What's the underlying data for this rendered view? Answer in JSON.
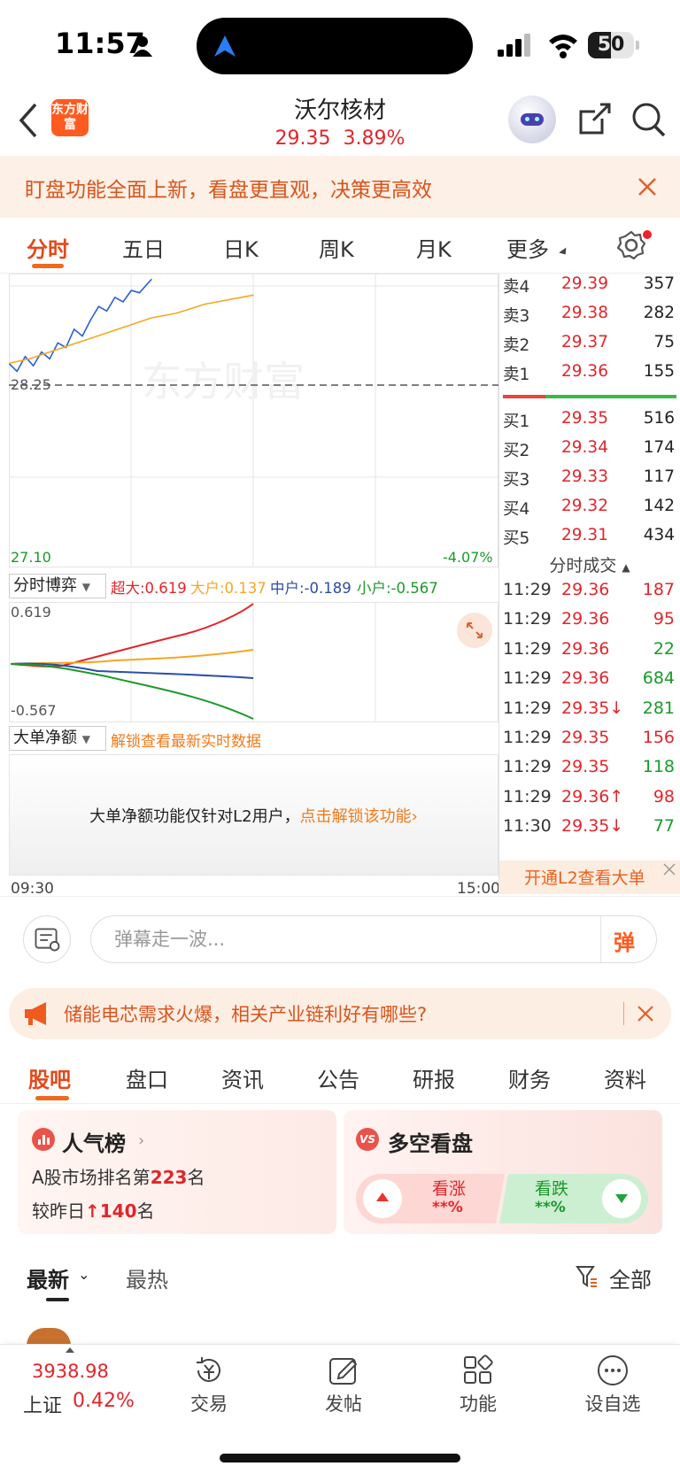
{
  "status_bar": {
    "time": "11:57",
    "battery": "50"
  },
  "header": {
    "logo": "东方财富",
    "stock_name": "沃尔核材",
    "price": "29.35",
    "change_pct": "3.89%"
  },
  "banner": {
    "text": "盯盘功能全面上新，看盘更直观，决策更高效"
  },
  "period_tabs": [
    "分时",
    "五日",
    "日K",
    "周K",
    "月K",
    "更多"
  ],
  "chart": {
    "watermark": "东方财富",
    "basis_price": "28.25",
    "low_price": "27.10",
    "low_pct": "-4.07%",
    "time_start": "09:30",
    "time_end": "15:00",
    "colors": {
      "price_line": "#2b5fd6",
      "avg_line": "#f5a623",
      "basis": "#555555"
    }
  },
  "chart_data": {
    "type": "line",
    "title": "",
    "series": [
      {
        "name": "",
        "points": [
          [
            0,
            28.72
          ],
          [
            4,
            28.65
          ],
          [
            8,
            28.78
          ],
          [
            12,
            28.7
          ],
          [
            16,
            28.82
          ],
          [
            20,
            28.76
          ],
          [
            24,
            28.9
          ],
          [
            28,
            28.86
          ],
          [
            32,
            29.02
          ],
          [
            36,
            28.96
          ],
          [
            40,
            29.1
          ],
          [
            44,
            29.22
          ],
          [
            48,
            29.18
          ],
          [
            52,
            29.3
          ],
          [
            56,
            29.26
          ],
          [
            60,
            29.36
          ],
          [
            64,
            29.34
          ],
          [
            68,
            29.42
          ],
          [
            70,
            29.46
          ]
        ]
      },
      {
        "name": "",
        "points": [
          [
            0,
            28.72
          ],
          [
            10,
            28.76
          ],
          [
            20,
            28.82
          ],
          [
            30,
            28.88
          ],
          [
            40,
            28.94
          ],
          [
            50,
            29.0
          ],
          [
            60,
            29.06
          ],
          [
            70,
            29.12
          ],
          [
            82,
            29.16
          ],
          [
            96,
            29.24
          ],
          [
            120,
            29.32
          ]
        ]
      }
    ],
    "xlabel": "",
    "ylabel": "",
    "ylim": [
      27.1,
      29.4
    ]
  },
  "game": {
    "selector": "分时博弈",
    "labels": [
      {
        "name": "超大",
        "value": ":0.619",
        "color": "#e0262b"
      },
      {
        "name": "大户",
        "value": ":0.137",
        "color": "#f5a623"
      },
      {
        "name": "中户",
        "value": ":-0.189",
        "color": "#2c4fa0"
      },
      {
        "name": "小户",
        "value": ":-0.567",
        "color": "#1a9a2a"
      }
    ],
    "top_label": "0.619",
    "bottom_label": "-0.567"
  },
  "big_order": {
    "selector": "大单净额",
    "unlock_link": "解锁查看最新实时数据",
    "message_prefix": "大单净额功能仅针对L2用户，",
    "message_link": "点击解锁该功能"
  },
  "order_book": {
    "sell": [
      {
        "label": "卖4",
        "price": "29.39",
        "volume": "357"
      },
      {
        "label": "卖3",
        "price": "29.38",
        "volume": "282"
      },
      {
        "label": "卖2",
        "price": "29.37",
        "volume": "75"
      },
      {
        "label": "卖1",
        "price": "29.36",
        "volume": "155"
      }
    ],
    "buy": [
      {
        "label": "买1",
        "price": "29.35",
        "volume": "516"
      },
      {
        "label": "买2",
        "price": "29.34",
        "volume": "174"
      },
      {
        "label": "买3",
        "price": "29.33",
        "volume": "117"
      },
      {
        "label": "买4",
        "price": "29.32",
        "volume": "142"
      },
      {
        "label": "买5",
        "price": "29.31",
        "volume": "434"
      }
    ]
  },
  "trades": {
    "header": "分时成交",
    "rows": [
      {
        "time": "11:29",
        "price": "29.36",
        "volume": "187",
        "color": "#e0262b"
      },
      {
        "time": "11:29",
        "price": "29.36",
        "volume": "95",
        "color": "#e0262b"
      },
      {
        "time": "11:29",
        "price": "29.36",
        "volume": "22",
        "color": "#1a9a2a"
      },
      {
        "time": "11:29",
        "price": "29.36",
        "volume": "684",
        "color": "#1a9a2a"
      },
      {
        "time": "11:29",
        "price": "29.35↓",
        "volume": "281",
        "color": "#1a9a2a"
      },
      {
        "time": "11:29",
        "price": "29.35",
        "volume": "156",
        "color": "#e0262b"
      },
      {
        "time": "11:29",
        "price": "29.35",
        "volume": "118",
        "color": "#1a9a2a"
      },
      {
        "time": "11:29",
        "price": "29.36↑",
        "volume": "98",
        "color": "#e0262b"
      },
      {
        "time": "11:30",
        "price": "29.35↓",
        "volume": "77",
        "color": "#1a9a2a"
      }
    ],
    "l2_cta": "开通L2查看大单"
  },
  "danmaku": {
    "placeholder": "弹幕走一波...",
    "button": "弹"
  },
  "news": {
    "text": "储能电芯需求火爆，相关产业链利好有哪些?"
  },
  "content_tabs": [
    "股吧",
    "盘口",
    "资讯",
    "公告",
    "研报",
    "财务",
    "资料"
  ],
  "popularity": {
    "title": "人气榜",
    "rank_prefix": "A股市场排名第",
    "rank": "223",
    "rank_suffix": "名",
    "change_prefix": "较昨日",
    "change": "140",
    "change_suffix": "名"
  },
  "sentiment": {
    "title": "多空看盘",
    "up_label": "看涨",
    "up_pct": "**%",
    "down_label": "看跌",
    "down_pct": "**%"
  },
  "feed": {
    "latest": "最新",
    "hot": "最热",
    "filter": "全部"
  },
  "bottom_nav": {
    "index_value": "3938.98",
    "index_name": "上证",
    "index_pct": "0.42%",
    "items": [
      "交易",
      "发帖",
      "功能",
      "设自选"
    ]
  }
}
